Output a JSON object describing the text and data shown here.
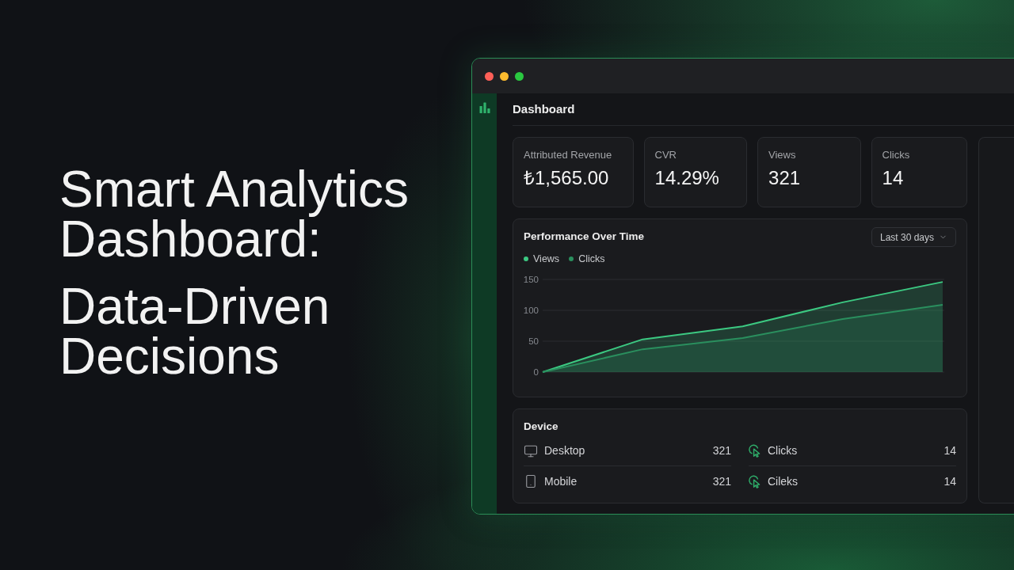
{
  "headline": {
    "title": "Smart Analytics Dashboard:",
    "subtitle": "Data-Driven Decisions"
  },
  "window": {
    "title": "Dashboard",
    "stats": [
      {
        "label": "Attributed Revenue",
        "value": "₺1,565.00"
      },
      {
        "label": "CVR",
        "value": "14.29%"
      },
      {
        "label": "Views",
        "value": "321"
      },
      {
        "label": "Clicks",
        "value": "14"
      }
    ],
    "performance": {
      "title": "Performance Over Time",
      "range": "Last 30 days",
      "chart_data": {
        "type": "area",
        "stacked": false,
        "ylim": [
          0,
          150
        ],
        "yticks": [
          0,
          50,
          100,
          150
        ],
        "series": [
          {
            "name": "Views",
            "color": "#3cc982",
            "values": [
              0,
              53,
              74,
              113,
              146
            ]
          },
          {
            "name": "Clicks",
            "color": "#2a8f5e",
            "values": [
              0,
              37,
              55,
              86,
              109
            ]
          }
        ]
      }
    },
    "device": {
      "title": "Device",
      "devices": [
        {
          "kind": "desktop",
          "label": "Desktop",
          "value": "321"
        },
        {
          "kind": "mobile",
          "label": "Mobile",
          "value": "321"
        }
      ],
      "metrics": [
        {
          "label": "Clicks",
          "value": "14"
        },
        {
          "label": "Cileks",
          "value": "14"
        }
      ]
    }
  }
}
